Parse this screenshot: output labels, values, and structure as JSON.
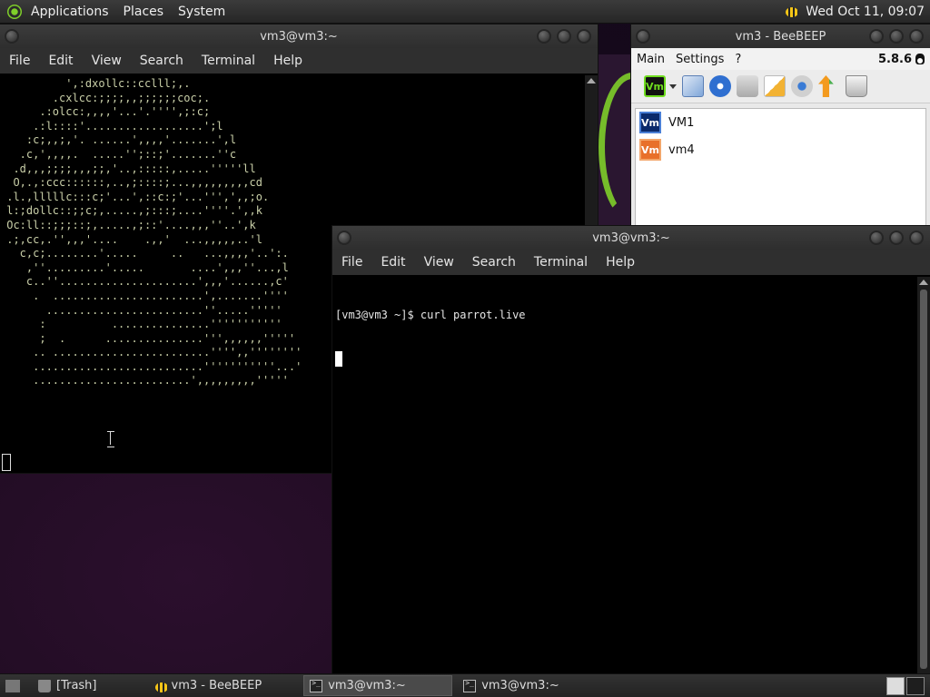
{
  "top_panel": {
    "menus": [
      "Applications",
      "Places",
      "System"
    ],
    "clock": "Wed Oct 11, 09:07"
  },
  "window_bg_terminal": {
    "title": "vm3@vm3:~",
    "menu": [
      "File",
      "Edit",
      "View",
      "Search",
      "Terminal",
      "Help"
    ],
    "ascii_lines": [
      "          ',:dxollc::cclll;,.",
      "        .cxlcc:;;;;,,;;;;;;coc;.",
      "      .:olcc:,,,,'...'.'''',;:c;",
      "     .:l::::'..................';l",
      "    :c;,,;,'. ......',,,,'.......',l",
      "   .c,',,,,.  .....'';::;'.......''c",
      "  .d,,,;;;;,,,;;,'..,:::::,.....'''''ll",
      "  O,.,:ccc::::::,..,;::::;...,,,,,,,,,cd",
      " .l.,lllllc:::c;'...',::c:;'...''',',,;o.",
      " l:;dollc::;;c;,.....,;:::;....''''.',,k",
      " Oc:ll::;;;::;,.....,;::'....,,,''..',k",
      " .;,cc,.'',,,'....    .,,'  ...,,,,,..'l",
      "   c,c;........'.....     ..   ...,,,,'..':.",
      "    ,''.........'.....       ....',,,''...,l",
      "    c..''.....................',,,'......,c'",
      "     .  .......................',.......''''",
      "       ........................''.....'''''",
      "      :          ...............'''''''''''",
      "      ;  .      ...............''',,,,,,'''''",
      "     .. ........................'''',,''''''''",
      "     ..........................'''''''''''...'",
      "     ........................',,,,,,,,,'''''"
    ]
  },
  "beebeep": {
    "title": "vm3 - BeeBEEP",
    "menu": [
      "Main",
      "Settings",
      "?"
    ],
    "version": "5.8.6",
    "logo_text": "Vm",
    "users": [
      {
        "name": "VM1",
        "badge": "Vm",
        "color": "#0b2a6b",
        "border": "#4a7fd6"
      },
      {
        "name": "vm4",
        "badge": "Vm",
        "color": "#e8702a",
        "border": "#f3a66a"
      }
    ]
  },
  "window_fg_terminal": {
    "title": "vm3@vm3:~",
    "menu": [
      "File",
      "Edit",
      "View",
      "Search",
      "Terminal",
      "Help"
    ],
    "prompt_line": "[vm3@vm3 ~]$ curl parrot.live"
  },
  "taskbar": {
    "items": [
      "[Trash]",
      "vm3 - BeeBEEP",
      "vm3@vm3:~",
      "vm3@vm3:~"
    ]
  }
}
